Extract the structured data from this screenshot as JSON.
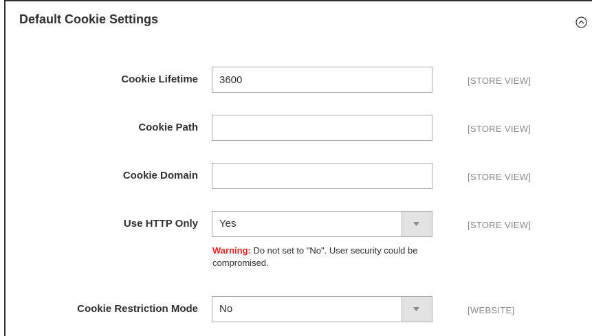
{
  "section": {
    "title": "Default Cookie Settings",
    "collapse_icon": "chevron-up-circle-icon"
  },
  "fields": {
    "cookie_lifetime": {
      "label": "Cookie Lifetime",
      "value": "3600",
      "scope": "[STORE VIEW]"
    },
    "cookie_path": {
      "label": "Cookie Path",
      "value": "",
      "scope": "[STORE VIEW]"
    },
    "cookie_domain": {
      "label": "Cookie Domain",
      "value": "",
      "scope": "[STORE VIEW]"
    },
    "use_http_only": {
      "label": "Use HTTP Only",
      "value": "Yes",
      "scope": "[STORE VIEW]",
      "warning_label": "Warning:",
      "warning_text": " Do not set to \"No\". User security could be compromised."
    },
    "cookie_restriction_mode": {
      "label": "Cookie Restriction Mode",
      "value": "No",
      "scope": "[WEBSITE]"
    }
  },
  "colors": {
    "warning": "#e22626",
    "scope_text": "#8a8a8a",
    "border": "#adadad"
  }
}
